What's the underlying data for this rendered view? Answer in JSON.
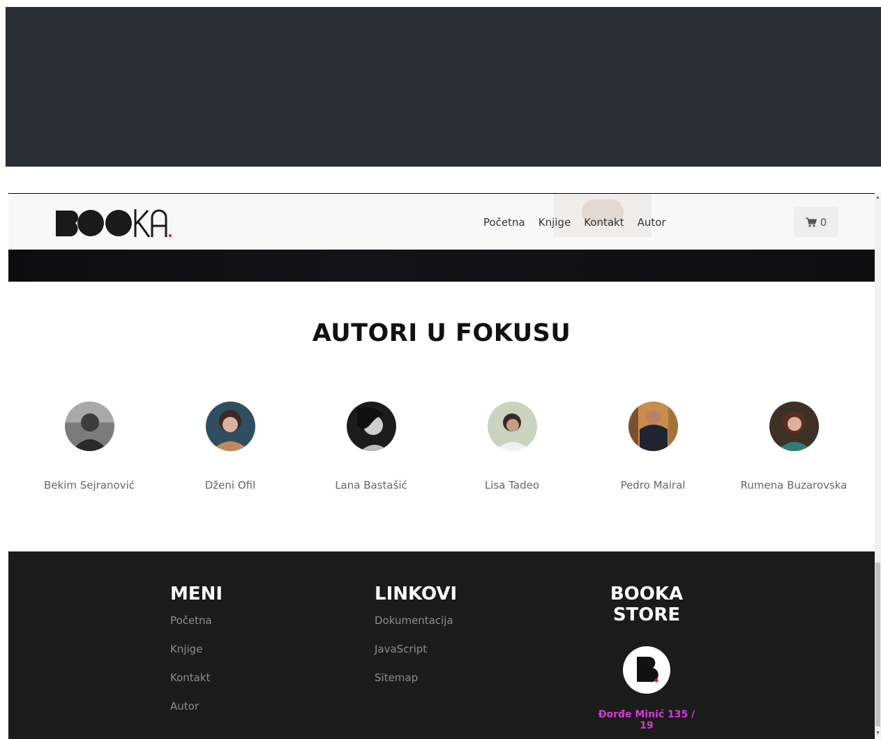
{
  "brand": {
    "name": "BOOKA"
  },
  "nav": {
    "links": [
      "Početna",
      "Knjige",
      "Kontakt",
      "Autor"
    ],
    "cart_count": "0"
  },
  "authors_section": {
    "title": "AUTORI U FOKUSU",
    "authors": [
      {
        "name": "Bekim Sejranović"
      },
      {
        "name": "Dženi Ofil"
      },
      {
        "name": "Lana Bastašić"
      },
      {
        "name": "Lisa Tadeo"
      },
      {
        "name": "Pedro Mairal"
      },
      {
        "name": "Rumena Buzarovska"
      }
    ]
  },
  "footer": {
    "menu": {
      "title": "MENI",
      "items": [
        "Početna",
        "Knjige",
        "Kontakt",
        "Autor"
      ]
    },
    "links": {
      "title": "LINKOVI",
      "items": [
        "Dokumentacija",
        "JavaScript",
        "Sitemap"
      ]
    },
    "store": {
      "title_line1": "BOOKA",
      "title_line2": "STORE",
      "address": "Đorđe Minić 135 / 19"
    }
  },
  "colors": {
    "top_dark": "#2a2d35",
    "footer_bg": "#1b1b1b",
    "address_accent": "#d43ad6",
    "logo_dot": "#e5142c"
  }
}
